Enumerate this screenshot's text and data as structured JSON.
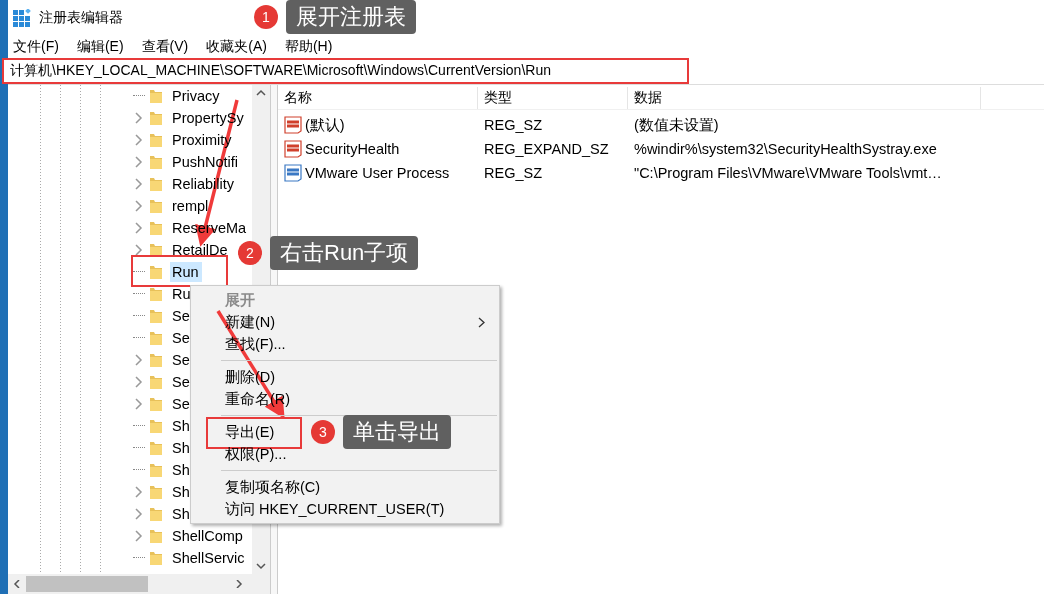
{
  "window": {
    "title": "注册表编辑器"
  },
  "menu_bar": [
    "文件(F)",
    "编辑(E)",
    "查看(V)",
    "收藏夹(A)",
    "帮助(H)"
  ],
  "address_bar": {
    "value": "计算机\\HKEY_LOCAL_MACHINE\\SOFTWARE\\Microsoft\\Windows\\CurrentVersion\\Run",
    "highlighted": true
  },
  "tree": {
    "items": [
      {
        "label": "Privacy",
        "expandable": false,
        "selected": false,
        "highlighted": false
      },
      {
        "label": "PropertySy",
        "expandable": true,
        "selected": false,
        "highlighted": false
      },
      {
        "label": "Proximity",
        "expandable": true,
        "selected": false,
        "highlighted": false
      },
      {
        "label": "PushNotifi",
        "expandable": true,
        "selected": false,
        "highlighted": false
      },
      {
        "label": "Reliability",
        "expandable": true,
        "selected": false,
        "highlighted": false
      },
      {
        "label": "rempl",
        "expandable": true,
        "selected": false,
        "highlighted": false
      },
      {
        "label": "ReserveMa",
        "expandable": true,
        "selected": false,
        "highlighted": false
      },
      {
        "label": "RetailDe",
        "expandable": true,
        "selected": false,
        "highlighted": false
      },
      {
        "label": "Run",
        "expandable": false,
        "selected": true,
        "highlighted": true
      },
      {
        "label": "Ru",
        "expandable": false,
        "selected": false,
        "highlighted": false
      },
      {
        "label": "Se",
        "expandable": false,
        "selected": false,
        "highlighted": false
      },
      {
        "label": "Se",
        "expandable": false,
        "selected": false,
        "highlighted": false
      },
      {
        "label": "Se",
        "expandable": true,
        "selected": false,
        "highlighted": false
      },
      {
        "label": "Se",
        "expandable": true,
        "selected": false,
        "highlighted": false
      },
      {
        "label": "Se",
        "expandable": true,
        "selected": false,
        "highlighted": false
      },
      {
        "label": "Sh",
        "expandable": false,
        "selected": false,
        "highlighted": false
      },
      {
        "label": "Sh",
        "expandable": false,
        "selected": false,
        "highlighted": false
      },
      {
        "label": "Sh",
        "expandable": false,
        "selected": false,
        "highlighted": false
      },
      {
        "label": "Sh",
        "expandable": true,
        "selected": false,
        "highlighted": false
      },
      {
        "label": "Sh",
        "expandable": true,
        "selected": false,
        "highlighted": false
      },
      {
        "label": "ShellComp",
        "expandable": true,
        "selected": false,
        "highlighted": false
      },
      {
        "label": "ShellServic",
        "expandable": false,
        "selected": false,
        "highlighted": false
      }
    ]
  },
  "values_list": {
    "columns": [
      "名称",
      "类型",
      "数据"
    ],
    "rows": [
      {
        "name": "(默认)",
        "type": "REG_SZ",
        "data": "(数值未设置)",
        "color": "#d0402c"
      },
      {
        "name": "SecurityHealth",
        "type": "REG_EXPAND_SZ",
        "data": "%windir%\\system32\\SecurityHealthSystray.exe",
        "color": "#d0402c"
      },
      {
        "name": "VMware User Process",
        "type": "REG_SZ",
        "data": "\"C:\\Program Files\\VMware\\VMware Tools\\vmt…",
        "color": "#3a78c4"
      }
    ]
  },
  "context_menu": {
    "items": [
      {
        "kind": "item",
        "label": "展开",
        "default": true,
        "disabled": true,
        "submenu": false,
        "highlighted": false
      },
      {
        "kind": "item",
        "label": "新建(N)",
        "default": false,
        "disabled": false,
        "submenu": true,
        "highlighted": false
      },
      {
        "kind": "item",
        "label": "查找(F)...",
        "default": false,
        "disabled": false,
        "submenu": false,
        "highlighted": false
      },
      {
        "kind": "separator"
      },
      {
        "kind": "item",
        "label": "删除(D)",
        "default": false,
        "disabled": false,
        "submenu": false,
        "highlighted": false
      },
      {
        "kind": "item",
        "label": "重命名(R)",
        "default": false,
        "disabled": false,
        "submenu": false,
        "highlighted": false
      },
      {
        "kind": "separator"
      },
      {
        "kind": "item",
        "label": "导出(E)",
        "default": false,
        "disabled": false,
        "submenu": false,
        "highlighted": true
      },
      {
        "kind": "item",
        "label": "权限(P)...",
        "default": false,
        "disabled": false,
        "submenu": false,
        "highlighted": false
      },
      {
        "kind": "separator"
      },
      {
        "kind": "item",
        "label": "复制项名称(C)",
        "default": false,
        "disabled": false,
        "submenu": false,
        "highlighted": false
      },
      {
        "kind": "item",
        "label": "访问 HKEY_CURRENT_USER(T)",
        "default": false,
        "disabled": false,
        "submenu": false,
        "highlighted": false
      }
    ]
  },
  "annotations": [
    {
      "number": "1",
      "text": "展开注册表"
    },
    {
      "number": "2",
      "text": "右击Run子项"
    },
    {
      "number": "3",
      "text": "单击导出"
    }
  ]
}
